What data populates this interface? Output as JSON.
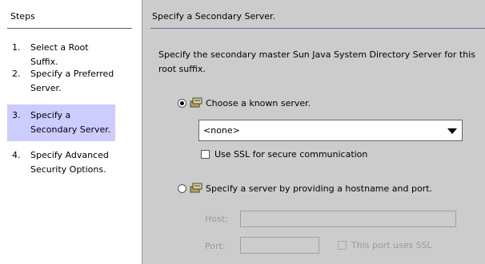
{
  "steps": {
    "header": "Steps",
    "items": [
      {
        "num": "1.",
        "label": "Select a Root Suffix."
      },
      {
        "num": "2.",
        "label": "Specify a Preferred Server."
      },
      {
        "num": "3.",
        "label": "Specify a Secondary Server."
      },
      {
        "num": "4.",
        "label": "Specify Advanced Security Options."
      }
    ]
  },
  "main": {
    "title": "Specify a Secondary Server.",
    "description": "Specify the secondary master Sun Java System Directory Server for this root suffix.",
    "known_server": {
      "label": "Choose a known server.",
      "selected": true,
      "dropdown_value": "<none>",
      "ssl_label": "Use SSL for secure communication"
    },
    "hostname_option": {
      "label": "Specify a server by providing a hostname and port.",
      "selected": false,
      "host_label": "Host:",
      "port_label": "Port:",
      "port_ssl_label": "This port uses SSL"
    }
  }
}
